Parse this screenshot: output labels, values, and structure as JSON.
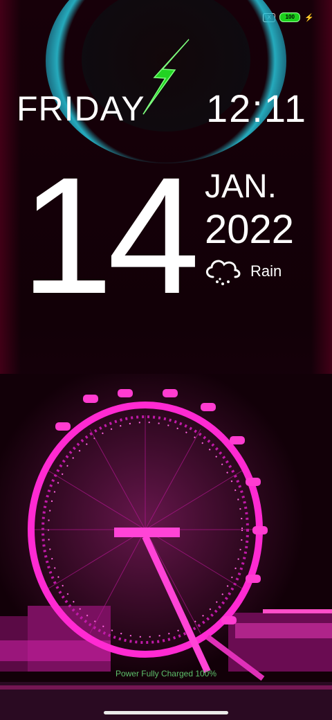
{
  "status_bar": {
    "sim_icon": "x",
    "battery_level": "100",
    "charging_icon": "lightning-icon"
  },
  "lockscreen": {
    "day_of_week": "FRIDAY",
    "time": "12:11",
    "day_number": "14",
    "month": "JAN.",
    "year": "2022",
    "weather_condition": "Rain",
    "weather_icon": "rain-cloud-icon"
  },
  "charging": {
    "status_text": "Power Fully Charged 100%",
    "bolt_color": "#22d322",
    "ring_color": "#3ad7e0"
  },
  "wallpaper": {
    "subject": "illuminated ferris wheel",
    "accent_color": "#ff1fb4"
  }
}
